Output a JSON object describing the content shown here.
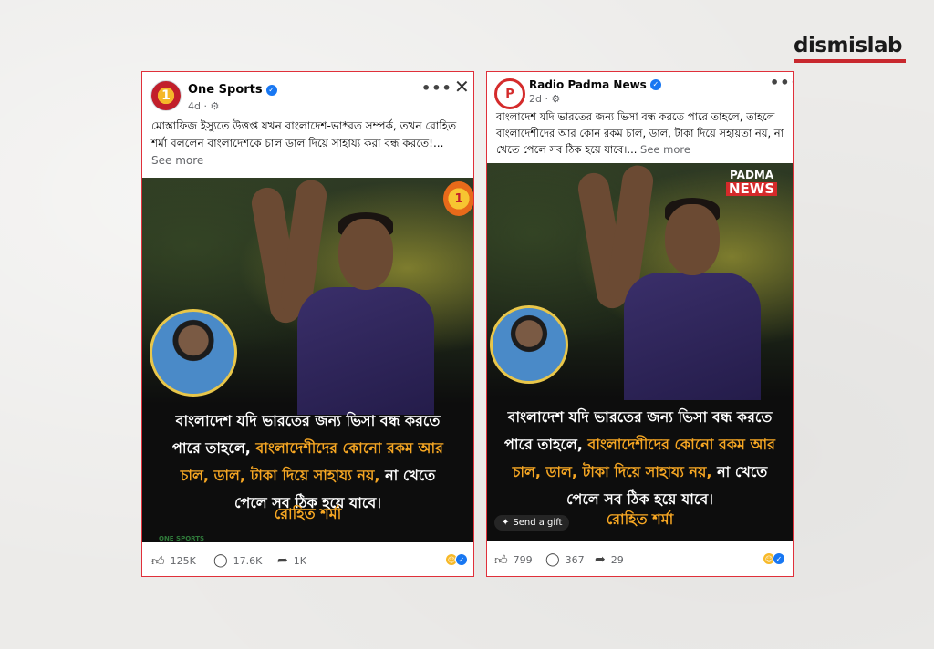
{
  "brand": {
    "name": "dismislab",
    "accent": "#c8282e"
  },
  "posts": [
    {
      "page_name": "One Sports",
      "avatar_letter": "1",
      "time": "4d · ⚙",
      "caption": "মোস্তাফিজ ইস্যুতে উত্তপ্ত যখন বাংলাদেশ-ভা*রত সম্পর্ক, তখন রোহিত শর্মা বললেন বাংলাদেশকে চাল ডাল দিয়ে সাহায্য করা বন্ধ করতে!...",
      "see_more": "See more",
      "badge": "1",
      "media_text_white": "বাংলাদেশ যদি ভারতের জন্য ভিসা বন্ধ করতে পারে তাহলে,",
      "media_text_orange": "বাংলাদেশীদের কোনো রকম আর চাল, ডাল, টাকা দিয়ে সাহায্য নয়,",
      "media_text_white2": "না খেতে পেলে সব ঠিক হয়ে যাবে।",
      "signature": "রোহিত শর্মা",
      "watermark": "ONE SPORTS",
      "likes": "125K",
      "comments": "17.6K",
      "shares": "1K"
    },
    {
      "page_name": "Radio Padma News",
      "avatar_letter": "P",
      "time": "2d · ⚙",
      "caption": "বাংলাদেশ যদি ভারতের জন্য ভিসা বন্ধ করতে পারে তাহলে, তাহলে বাংলাদেশীদের আর কোন রকম চাল, ডাল, টাকা দিয়ে সহায়তা নয়, না খেতে পেলে সব ঠিক হয়ে যাবে।...",
      "see_more": "See more",
      "logo_line1": "PADMA",
      "logo_line2": "NEWS",
      "media_text_white": "বাংলাদেশ যদি ভারতের জন্য ভিসা বন্ধ করতে পারে তাহলে,",
      "media_text_orange": "বাংলাদেশীদের কোনো রকম আর চাল, ডাল, টাকা দিয়ে সাহায্য নয়,",
      "media_text_white2": "না খেতে পেলে সব ঠিক হয়ে যাবে।",
      "signature": "রোহিত শর্মা",
      "gift_label": "Send a gift",
      "likes": "799",
      "comments": "367",
      "shares": "29"
    }
  ],
  "icons": {
    "more": "more-dots-icon",
    "close": "close-icon",
    "like": "thumbs-up-icon",
    "comment": "comment-bubble-icon",
    "share": "share-arrow-icon"
  }
}
